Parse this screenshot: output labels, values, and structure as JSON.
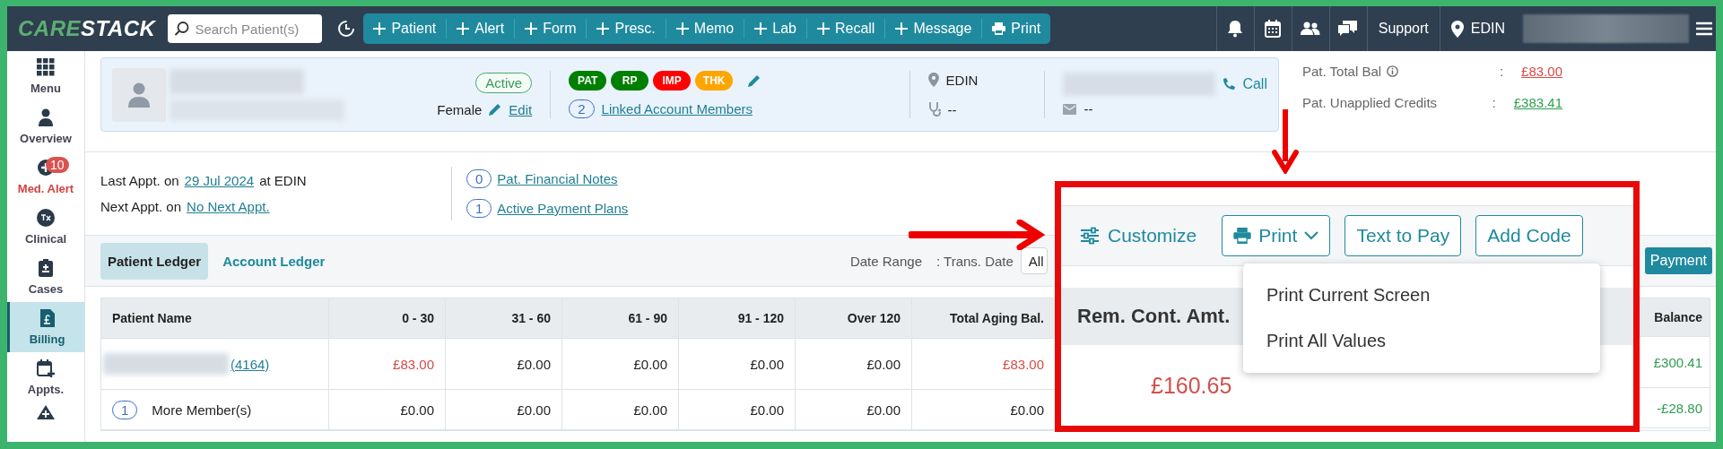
{
  "top_bar": {
    "logo": {
      "part_1": "CARE",
      "part_2": "STACK"
    },
    "search": {
      "placeholder": "Search Patient(s)"
    },
    "quick_actions": [
      {
        "label": "Patient",
        "kind": "add"
      },
      {
        "label": "Alert",
        "kind": "add"
      },
      {
        "label": "Form",
        "kind": "add"
      },
      {
        "label": "Presc.",
        "kind": "add"
      },
      {
        "label": "Memo",
        "kind": "add"
      },
      {
        "label": "Lab",
        "kind": "add"
      },
      {
        "label": "Recall",
        "kind": "add"
      },
      {
        "label": "Message",
        "kind": "add"
      },
      {
        "label": "Print",
        "kind": "print"
      }
    ],
    "support": "Support",
    "location": "EDIN"
  },
  "sidebar": {
    "items": [
      {
        "label": "Menu",
        "selected": false,
        "alert": false
      },
      {
        "label": "Overview",
        "selected": false,
        "alert": false
      },
      {
        "label": "Med. Alert",
        "selected": false,
        "alert": true,
        "badge": "10"
      },
      {
        "label": "Clinical",
        "selected": false,
        "alert": false
      },
      {
        "label": "Cases",
        "selected": false,
        "alert": false
      },
      {
        "label": "Billing",
        "selected": true,
        "alert": false
      },
      {
        "label": "Appts.",
        "selected": false,
        "alert": false
      }
    ]
  },
  "patient_card": {
    "status": "Active",
    "gender": "Female",
    "edit": "Edit",
    "tags": [
      {
        "label": "PAT",
        "color": "#008000"
      },
      {
        "label": "RP",
        "color": "#008000"
      },
      {
        "label": "IMP",
        "color": "#ff0000"
      },
      {
        "label": "THK",
        "color": "#ffa500"
      }
    ],
    "linked": {
      "count": "2",
      "label": "Linked Account Members"
    },
    "location": "EDIN",
    "provider": "--",
    "call": "Call",
    "email": "--"
  },
  "balances": [
    {
      "label": "Pat. Total Bal",
      "info": true,
      "sep": ":",
      "value": "£83.00",
      "color": "#d84a46"
    },
    {
      "label": "Pat. Unapplied Credits",
      "info": false,
      "sep": ":",
      "value": "£383.41",
      "color": "#2e9e50"
    }
  ],
  "appointments": [
    {
      "prefix": "Last Appt. on",
      "link": "29 Jul 2024",
      "suffix": "at EDIN"
    },
    {
      "prefix": "Next Appt. on",
      "link": "No Next Appt."
    }
  ],
  "notes": [
    {
      "count": "0",
      "label": "Pat. Financial Notes"
    },
    {
      "count": "1",
      "label": "Active Payment Plans"
    }
  ],
  "ledger_tabs": [
    {
      "label": "Patient Ledger",
      "selected": true
    },
    {
      "label": "Account Ledger",
      "selected": false
    }
  ],
  "filters": {
    "date_range": "Date Range",
    "trans_date": ": Trans. Date",
    "value": "All"
  },
  "aging_table": {
    "name_column": "Patient Name",
    "columns": [
      "0 - 30",
      "31 - 60",
      "61 - 90",
      "91 - 120",
      "Over 120",
      "Total Aging Bal."
    ],
    "rows": [
      {
        "kind": "patient",
        "id": "(4164)",
        "cells": [
          {
            "text": "£83.00",
            "color": "#d84a46"
          },
          {
            "text": "£0.00",
            "color": "#222222"
          },
          {
            "text": "£0.00",
            "color": "#222222"
          },
          {
            "text": "£0.00",
            "color": "#222222"
          },
          {
            "text": "£0.00",
            "color": "#222222"
          },
          {
            "text": "£83.00",
            "color": "#d84a46"
          }
        ]
      },
      {
        "kind": "members",
        "count": "1",
        "label": "More Member(s)",
        "cells": [
          {
            "text": "£0.00",
            "color": "#222222"
          },
          {
            "text": "£0.00",
            "color": "#222222"
          },
          {
            "text": "£0.00",
            "color": "#222222"
          },
          {
            "text": "£0.00",
            "color": "#222222"
          },
          {
            "text": "£0.00",
            "color": "#222222"
          },
          {
            "text": "£0.00",
            "color": "#222222"
          }
        ]
      }
    ]
  },
  "payment_button": "Payment",
  "balance_table": {
    "header": "Balance",
    "rows": [
      {
        "text": "£300.41",
        "color": "#2e9e50"
      },
      {
        "text": "-£28.80",
        "color": "#2e9e50"
      }
    ]
  },
  "inset": {
    "customize": "Customize",
    "print": "Print",
    "print_menu_open": true,
    "text_to_pay": "Text to Pay",
    "add_code": "Add Code",
    "print_menu": [
      "Print Current Screen",
      "Print All Values"
    ],
    "column": "Rem. Cont. Amt.",
    "amount": "£160.65"
  }
}
